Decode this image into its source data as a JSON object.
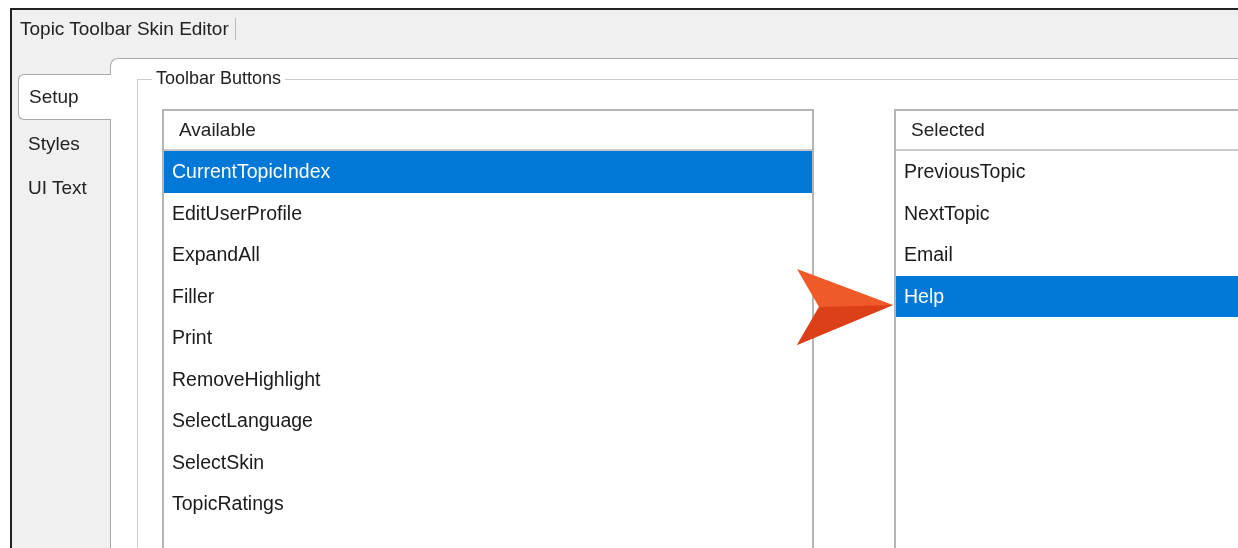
{
  "window": {
    "title": "Topic Toolbar Skin Editor"
  },
  "tabs": [
    {
      "label": "Setup",
      "selected": true
    },
    {
      "label": "Styles",
      "selected": false
    },
    {
      "label": "UI Text",
      "selected": false
    }
  ],
  "group": {
    "title": "Toolbar Buttons"
  },
  "lists": [
    {
      "header": "Available",
      "items": [
        {
          "label": "CurrentTopicIndex",
          "selected": true
        },
        {
          "label": "EditUserProfile",
          "selected": false
        },
        {
          "label": "ExpandAll",
          "selected": false
        },
        {
          "label": "Filler",
          "selected": false
        },
        {
          "label": "Print",
          "selected": false
        },
        {
          "label": "RemoveHighlight",
          "selected": false
        },
        {
          "label": "SelectLanguage",
          "selected": false
        },
        {
          "label": "SelectSkin",
          "selected": false
        },
        {
          "label": "TopicRatings",
          "selected": false
        }
      ]
    },
    {
      "header": "Selected",
      "items": [
        {
          "label": "PreviousTopic",
          "selected": false
        },
        {
          "label": "NextTopic",
          "selected": false
        },
        {
          "label": "Email",
          "selected": false
        },
        {
          "label": "Help",
          "selected": true
        }
      ]
    }
  ]
}
